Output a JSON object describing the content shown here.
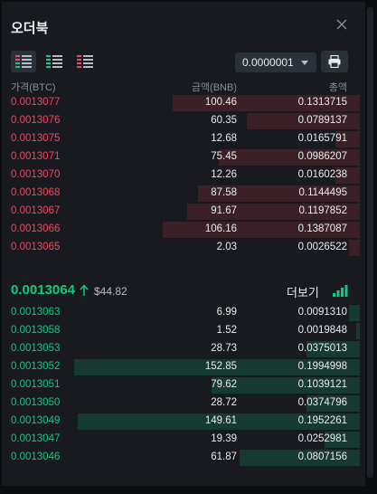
{
  "panel": {
    "title": "오더북"
  },
  "toolbar": {
    "tick_size": "0.0000001",
    "views": [
      "both-view-icon",
      "bids-view-icon",
      "asks-view-icon"
    ]
  },
  "columns": {
    "price": "가격(BTC)",
    "amount": "금액(BNB)",
    "total": "총액"
  },
  "asks": [
    {
      "price": "0.0013077",
      "amount": "100.46",
      "total": "0.1313715",
      "depth": 0.53
    },
    {
      "price": "0.0013076",
      "amount": "60.35",
      "total": "0.0789137",
      "depth": 0.32
    },
    {
      "price": "0.0013075",
      "amount": "12.68",
      "total": "0.0165791",
      "depth": 0.07
    },
    {
      "price": "0.0013071",
      "amount": "75.45",
      "total": "0.0986207",
      "depth": 0.4
    },
    {
      "price": "0.0013070",
      "amount": "12.26",
      "total": "0.0160238",
      "depth": 0.07
    },
    {
      "price": "0.0013068",
      "amount": "87.58",
      "total": "0.1144495",
      "depth": 0.46
    },
    {
      "price": "0.0013067",
      "amount": "91.67",
      "total": "0.1197852",
      "depth": 0.49
    },
    {
      "price": "0.0013066",
      "amount": "106.16",
      "total": "0.1387087",
      "depth": 0.56
    },
    {
      "price": "0.0013065",
      "amount": "2.03",
      "total": "0.0026522",
      "depth": 0.03
    }
  ],
  "mid": {
    "last_price": "0.0013064",
    "usd_price": "$44.82",
    "more_label": "더보기"
  },
  "bids": [
    {
      "price": "0.0013063",
      "amount": "6.99",
      "total": "0.0091310",
      "depth": 0.03
    },
    {
      "price": "0.0013058",
      "amount": "1.52",
      "total": "0.0019848",
      "depth": 0.01
    },
    {
      "price": "0.0013053",
      "amount": "28.73",
      "total": "0.0375013",
      "depth": 0.15
    },
    {
      "price": "0.0013052",
      "amount": "152.85",
      "total": "0.1994998",
      "depth": 0.81
    },
    {
      "price": "0.0013051",
      "amount": "79.62",
      "total": "0.1039121",
      "depth": 0.42
    },
    {
      "price": "0.0013050",
      "amount": "28.72",
      "total": "0.0374796",
      "depth": 0.15
    },
    {
      "price": "0.0013049",
      "amount": "149.61",
      "total": "0.1952261",
      "depth": 0.8
    },
    {
      "price": "0.0013047",
      "amount": "19.39",
      "total": "0.0252981",
      "depth": 0.1
    },
    {
      "price": "0.0013046",
      "amount": "61.87",
      "total": "0.0807156",
      "depth": 0.34
    }
  ],
  "colors": {
    "ask": "#f6465d",
    "bid": "#0ecb81",
    "ask_bar": "#3b2127",
    "bid_bar": "#163a30",
    "bg": "#181a20"
  }
}
